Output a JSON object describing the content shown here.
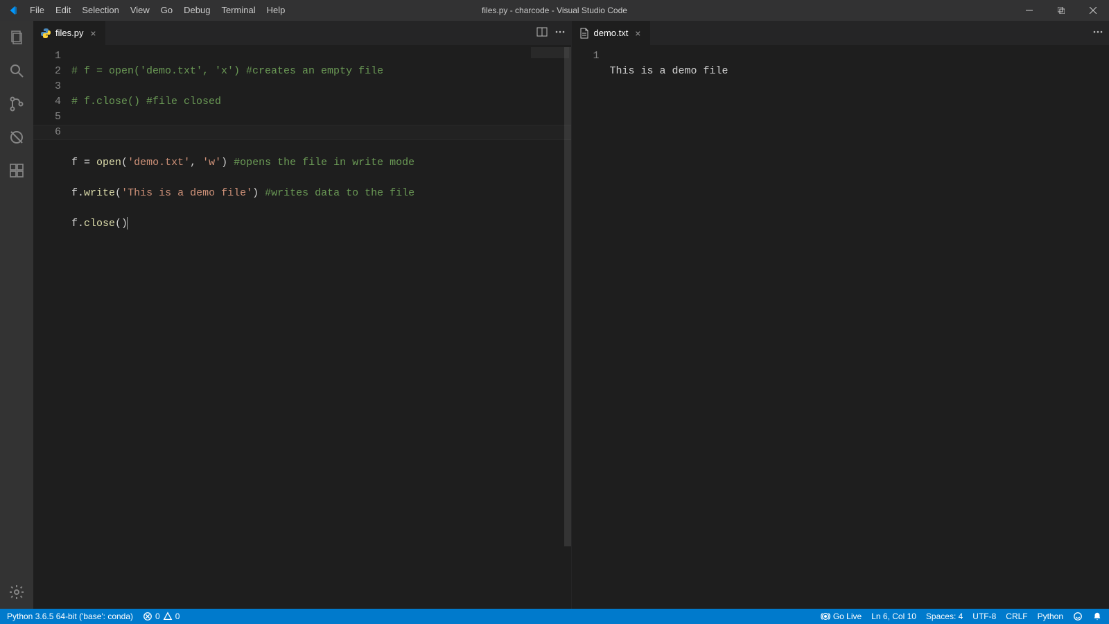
{
  "title": "files.py - charcode - Visual Studio Code",
  "menus": [
    "File",
    "Edit",
    "Selection",
    "View",
    "Go",
    "Debug",
    "Terminal",
    "Help"
  ],
  "tabs_left": {
    "name": "files.py",
    "dirty": false
  },
  "tabs_right": {
    "name": "demo.txt",
    "dirty": false
  },
  "left_code": {
    "numbers": [
      "1",
      "2",
      "3",
      "4",
      "5",
      "6"
    ],
    "l1": "# f = open('demo.txt', 'x') #creates an empty file",
    "l2": "# f.close() #file closed",
    "l3": "",
    "l4_id": "f",
    "l4_eq": " = ",
    "l4_fn": "open",
    "l4_p1": "(",
    "l4_s1": "'demo.txt'",
    "l4_c1": ", ",
    "l4_s2": "'w'",
    "l4_p2": ") ",
    "l4_cm": "#opens the file in write mode",
    "l5_id": "f",
    "l5_dot": ".",
    "l5_fn": "write",
    "l5_p1": "(",
    "l5_s": "'This is a demo file'",
    "l5_p2": ") ",
    "l5_cm": "#writes data to the file",
    "l6_id": "f",
    "l6_dot": ".",
    "l6_fn": "close",
    "l6_p": "()"
  },
  "right_code": {
    "numbers": [
      "1"
    ],
    "l1": "This is a demo file"
  },
  "status": {
    "python": "Python 3.6.5 64-bit ('base': conda)",
    "errors": "0",
    "warnings": "0",
    "golive": "Go Live",
    "lncol": "Ln 6, Col 10",
    "spaces": "Spaces: 4",
    "encoding": "UTF-8",
    "eol": "CRLF",
    "lang": "Python"
  }
}
